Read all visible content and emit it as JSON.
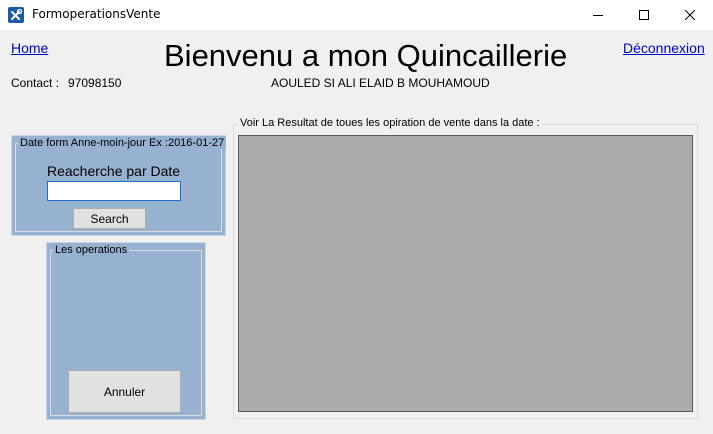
{
  "window": {
    "title": "FormoperationsVente",
    "icon": "wrench-screwdriver-icon",
    "colors": {
      "icon": "#1e5aa8"
    }
  },
  "header": {
    "home_link": "Home",
    "logout_link": "Déconnexion",
    "title": "Bienvenu a mon Quincaillerie",
    "contact_label": "Contact :",
    "contact_value": "97098150",
    "owner": "AOULED SI ALI ELAID B MOUHAMOUD"
  },
  "search_panel": {
    "caption": "Date form Anne-moin-jour Ex :2016-01-27",
    "heading": "Reacherche par Date",
    "date_value": "",
    "search_label": "Search"
  },
  "operations_panel": {
    "caption": "Les operations",
    "cancel_label": "Annuler"
  },
  "results": {
    "caption": "Voir La Resultat de toues les opiration de vente dans la date :"
  },
  "colors": {
    "panel_bg": "#97b1d1",
    "grid_bg": "#ababab",
    "link": "#0000cc",
    "client_bg": "#f0f0f0"
  }
}
